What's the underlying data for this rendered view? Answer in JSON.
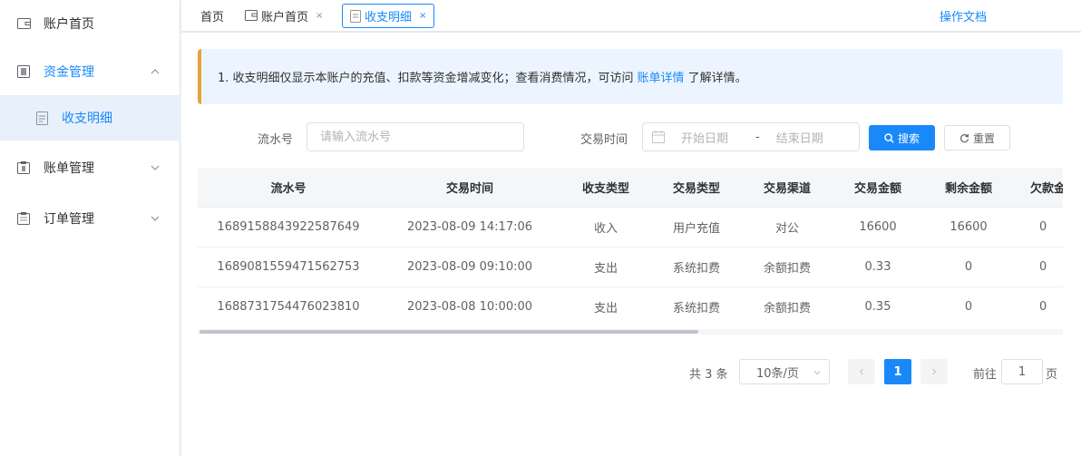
{
  "sidebar": {
    "items": [
      {
        "label": "账户首页",
        "icon": "wallet-icon"
      },
      {
        "label": "资金管理",
        "icon": "fund-icon",
        "expanded": true
      },
      {
        "label": "账单管理",
        "icon": "bill-icon"
      },
      {
        "label": "订单管理",
        "icon": "order-icon"
      }
    ],
    "sub_items": [
      {
        "label": "收支明细",
        "icon": "document-icon",
        "active": true
      }
    ]
  },
  "tabs": {
    "home": "首页",
    "account_home": "账户首页",
    "detail": "收支明细",
    "close_glyph": "×"
  },
  "doc_link": "操作文档",
  "notice": {
    "prefix": "1. 收支明细仅显示本账户的充值、扣款等资金增减变化；查看消费情况，可访问",
    "link": "账单详情",
    "suffix": "了解详情。"
  },
  "filters": {
    "serial_label": "流水号",
    "serial_placeholder": "请输入流水号",
    "time_label": "交易时间",
    "start_placeholder": "开始日期",
    "separator": "-",
    "end_placeholder": "结束日期",
    "search_label": "搜索",
    "reset_label": "重置"
  },
  "table": {
    "columns": [
      "流水号",
      "交易时间",
      "收支类型",
      "交易类型",
      "交易渠道",
      "交易金额",
      "剩余金额",
      "欠款金额"
    ],
    "rows": [
      [
        "1689158843922587649",
        "2023-08-09 14:17:06",
        "收入",
        "用户充值",
        "对公",
        "16600",
        "16600",
        "0"
      ],
      [
        "1689081559471562753",
        "2023-08-09 09:10:00",
        "支出",
        "系统扣费",
        "余额扣费",
        "0.33",
        "0",
        "0"
      ],
      [
        "1688731754476023810",
        "2023-08-08 10:00:00",
        "支出",
        "系统扣费",
        "余额扣费",
        "0.35",
        "0",
        "0"
      ]
    ]
  },
  "pagination": {
    "total": "共 3 条",
    "page_size": "10条/页",
    "current": "1",
    "goto_label": "前往",
    "goto_value": "1",
    "page_suffix": "页"
  },
  "colors": {
    "primary": "#1989fa",
    "notice_bar": "#e6a23c",
    "notice_bg": "#ecf5ff",
    "active_bg": "#e8f0fb"
  }
}
